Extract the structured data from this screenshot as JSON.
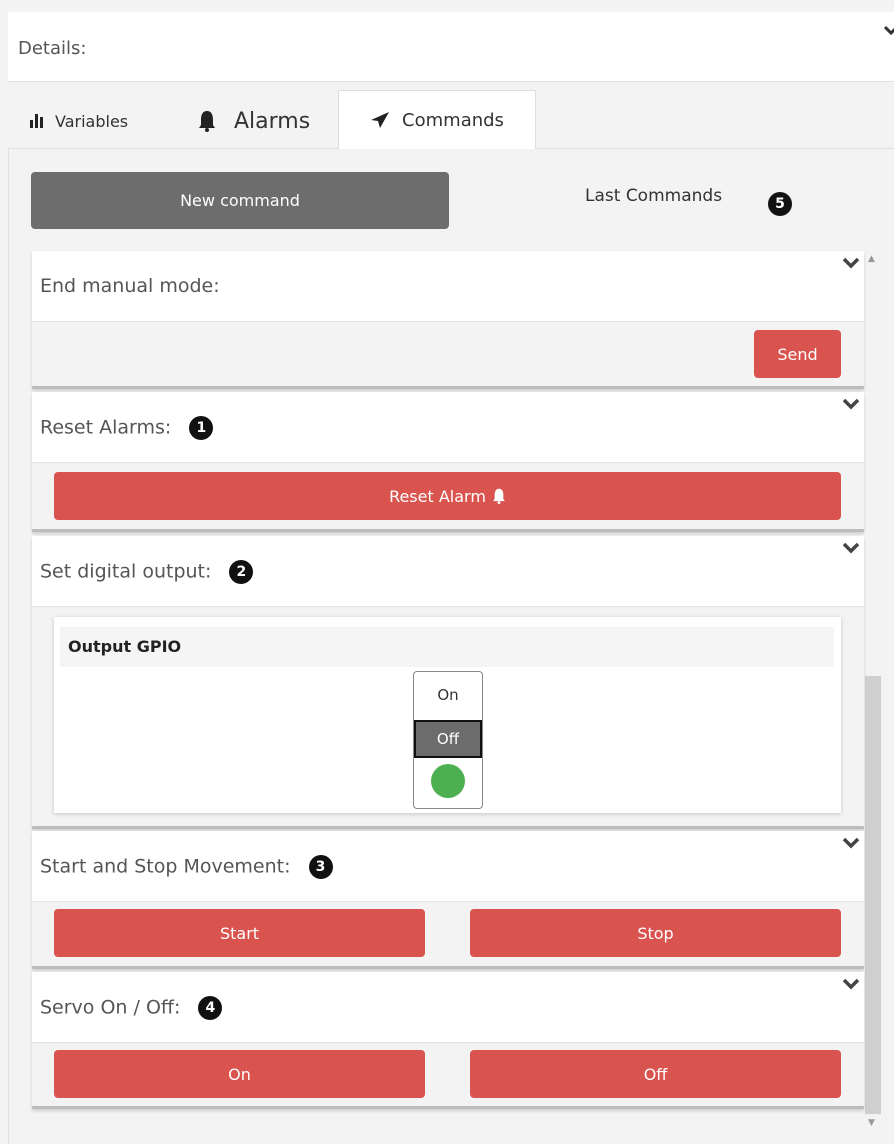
{
  "details": {
    "label": "Details:"
  },
  "tabs": [
    {
      "label": "Variables",
      "icon": "bar-chart-icon"
    },
    {
      "label": "Alarms",
      "icon": "bell-icon"
    },
    {
      "label": "Commands",
      "icon": "paper-plane-icon"
    }
  ],
  "toolbar": {
    "new_command": "New command",
    "last_commands": "Last Commands",
    "last_commands_badge": "5"
  },
  "cards": {
    "end_manual": {
      "title": "End manual mode:",
      "send": "Send"
    },
    "reset_alarms": {
      "title": "Reset Alarms:",
      "badge": "1",
      "button": "Reset Alarm"
    },
    "digital_output": {
      "title": "Set digital output:",
      "badge": "2",
      "output_label": "Output GPIO",
      "on": "On",
      "off": "Off",
      "selected": "Off"
    },
    "movement": {
      "title": "Start and Stop Movement:",
      "badge": "3",
      "start": "Start",
      "stop": "Stop"
    },
    "servo": {
      "title": "Servo On / Off:",
      "badge": "4",
      "on": "On",
      "off": "Off"
    }
  },
  "colors": {
    "danger": "#d9534f",
    "primary_dark": "#6d6d6d",
    "led_on": "#4caf50"
  }
}
